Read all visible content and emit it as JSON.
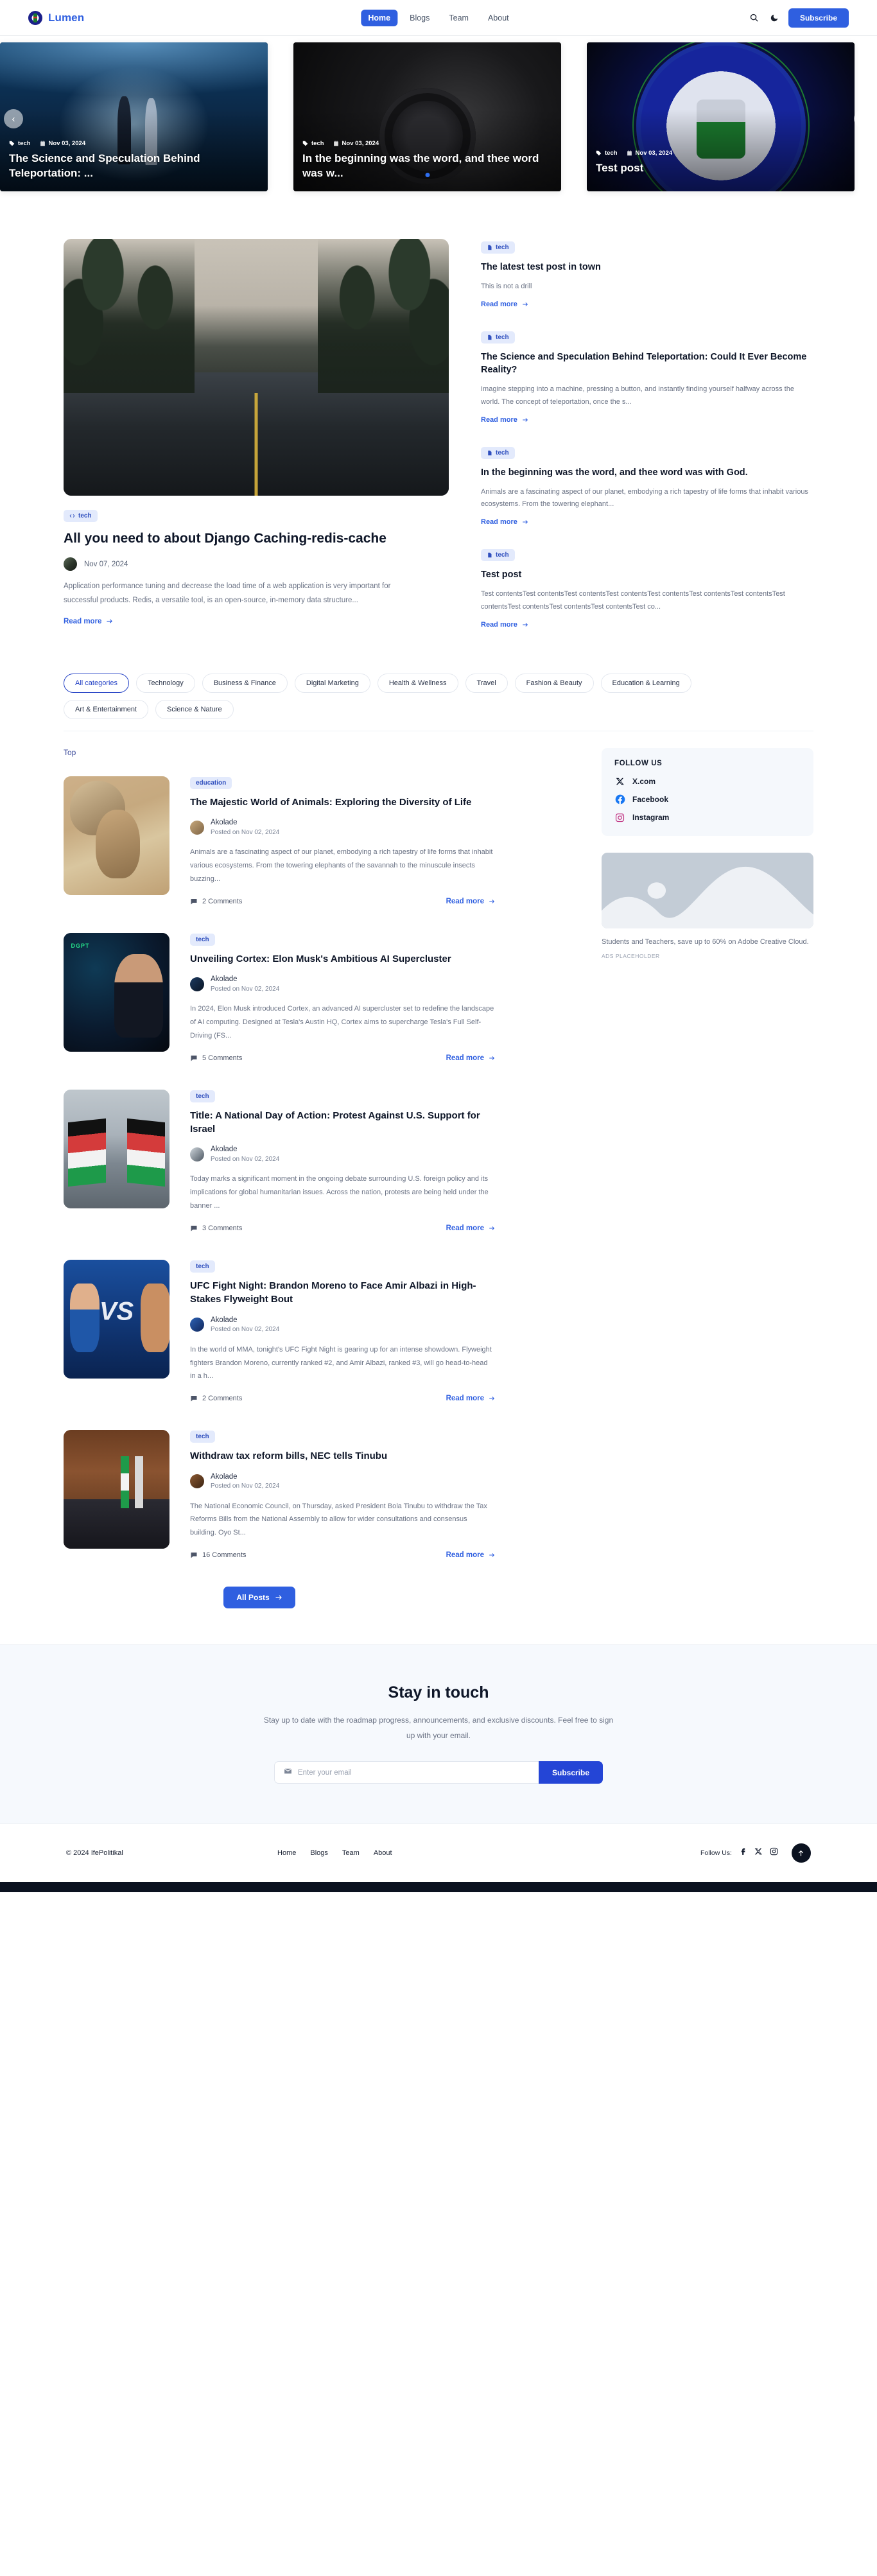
{
  "header": {
    "brand": "Lumen",
    "nav": [
      {
        "label": "Home",
        "active": true
      },
      {
        "label": "Blogs",
        "active": false
      },
      {
        "label": "Team",
        "active": false
      },
      {
        "label": "About",
        "active": false
      }
    ],
    "search_icon": "search-icon",
    "theme_icon": "moon-icon",
    "subscribe_label": "Subscribe"
  },
  "carousel": {
    "prev_label": "‹",
    "next_label": "›",
    "slides": [
      {
        "category": "tech",
        "date": "Nov 03, 2024",
        "title": "The Science and Speculation Behind Teleportation: ..."
      },
      {
        "category": "tech",
        "date": "Nov 03, 2024",
        "title": "In the beginning was the word, and thee word was w..."
      },
      {
        "category": "tech",
        "date": "Nov 03, 2024",
        "title": "Test post"
      }
    ],
    "active_dot": 1
  },
  "featured": {
    "tag": "tech",
    "title": "All you need to about Django Caching-redis-cache",
    "date": "Nov 07, 2024",
    "excerpt": "Application performance tuning and decrease the load time of a web application is very important for successful products. Redis, a versatile tool, is an open-source, in-memory data structure...",
    "read_more": "Read more"
  },
  "side_posts": [
    {
      "tag": "tech",
      "title": "The latest test post in town",
      "excerpt": "This is not a drill",
      "read_more": "Read more"
    },
    {
      "tag": "tech",
      "title": "The Science and Speculation Behind Teleportation: Could It Ever Become Reality?",
      "excerpt": "Imagine stepping into a machine, pressing a button, and instantly finding yourself halfway across the world. The concept of teleportation, once the s...",
      "read_more": "Read more"
    },
    {
      "tag": "tech",
      "title": "In the beginning was the word, and thee word was with God.",
      "excerpt": "Animals are a fascinating aspect of our planet, embodying a rich tapestry of life forms that inhabit various ecosystems. From the towering elephant...",
      "read_more": "Read more"
    },
    {
      "tag": "tech",
      "title": "Test post",
      "excerpt": "Test contentsTest contentsTest contentsTest contentsTest contentsTest contentsTest contentsTest contentsTest contentsTest contentsTest contentsTest co...",
      "read_more": "Read more"
    }
  ],
  "categories": [
    {
      "label": "All categories",
      "active": true
    },
    {
      "label": "Technology",
      "active": false
    },
    {
      "label": "Business & Finance",
      "active": false
    },
    {
      "label": "Digital Marketing",
      "active": false
    },
    {
      "label": "Health & Wellness",
      "active": false
    },
    {
      "label": "Travel",
      "active": false
    },
    {
      "label": "Fashion & Beauty",
      "active": false
    },
    {
      "label": "Education & Learning",
      "active": false
    },
    {
      "label": "Art & Entertainment",
      "active": false
    },
    {
      "label": "Science & Nature",
      "active": false
    }
  ],
  "list": {
    "top_label": "Top",
    "all_posts_label": "All Posts",
    "posts": [
      {
        "tag": "education",
        "title": "The Majestic World of Animals: Exploring the Diversity of Life",
        "author": "Akolade",
        "date": "Posted on Nov 02, 2024",
        "excerpt": "Animals are a fascinating aspect of our planet, embodying a rich tapestry of life forms that inhabit various ecosystems. From the towering elephants of the savannah to the minuscule insects buzzing...",
        "comments": "2 Comments",
        "read_more": "Read more"
      },
      {
        "tag": "tech",
        "title": "Unveiling Cortex: Elon Musk's Ambitious AI Supercluster",
        "author": "Akolade",
        "date": "Posted on Nov 02, 2024",
        "excerpt": "In 2024, Elon Musk introduced Cortex, an advanced AI supercluster set to redefine the landscape of AI computing. Designed at Tesla's Austin HQ, Cortex aims to supercharge Tesla's Full Self-Driving (FS...",
        "comments": "5 Comments",
        "read_more": "Read more"
      },
      {
        "tag": "tech",
        "title": "Title: A National Day of Action: Protest Against U.S. Support for Israel",
        "author": "Akolade",
        "date": "Posted on Nov 02, 2024",
        "excerpt": "Today marks a significant moment in the ongoing debate surrounding U.S. foreign policy and its implications for global humanitarian issues. Across the nation, protests are being held under the banner ...",
        "comments": "3 Comments",
        "read_more": "Read more"
      },
      {
        "tag": "tech",
        "title": "UFC Fight Night: Brandon Moreno to Face Amir Albazi in High-Stakes Flyweight Bout",
        "author": "Akolade",
        "date": "Posted on Nov 02, 2024",
        "excerpt": "In the world of MMA, tonight's UFC Fight Night is gearing up for an intense showdown. Flyweight fighters Brandon Moreno, currently ranked #2, and Amir Albazi, ranked #3, will go head-to-head in a h...",
        "comments": "2 Comments",
        "read_more": "Read more"
      },
      {
        "tag": "tech",
        "title": "Withdraw tax reform bills, NEC tells Tinubu",
        "author": "Akolade",
        "date": "Posted on Nov 02, 2024",
        "excerpt": "The National Economic Council, on Thursday, asked President Bola Tinubu to withdraw the Tax Reforms Bills from the National Assembly to allow for wider consultations and consensus building. Oyo St...",
        "comments": "16 Comments",
        "read_more": "Read more"
      }
    ]
  },
  "sidebar": {
    "follow_title": "FOLLOW US",
    "socials": [
      {
        "label": "X.com",
        "icon": "x-icon"
      },
      {
        "label": "Facebook",
        "icon": "facebook-icon"
      },
      {
        "label": "Instagram",
        "icon": "instagram-icon"
      }
    ],
    "ad_text": "Students and Teachers, save up to 60% on Adobe Creative Cloud.",
    "ad_note": "ADS PLACEHOLDER"
  },
  "newsletter": {
    "title": "Stay in touch",
    "subtitle": "Stay up to date with the roadmap progress, announcements, and exclusive discounts. Feel free to sign up with your email.",
    "placeholder": "Enter your email",
    "value": "",
    "submit_label": "Subscribe"
  },
  "footer": {
    "copyright": "© 2024 IfePolitikal",
    "nav": [
      "Home",
      "Blogs",
      "Team",
      "About"
    ],
    "follow_us_label": "Follow Us:",
    "socials": [
      "facebook-icon",
      "x-icon",
      "instagram-icon"
    ],
    "to_top_icon": "arrow-up-icon"
  },
  "colors": {
    "accent": "#2f5fe0",
    "accent_dark": "#2445d6",
    "tag_bg": "#e3eafc",
    "text": "#0e1628",
    "muted": "#6b7385"
  }
}
